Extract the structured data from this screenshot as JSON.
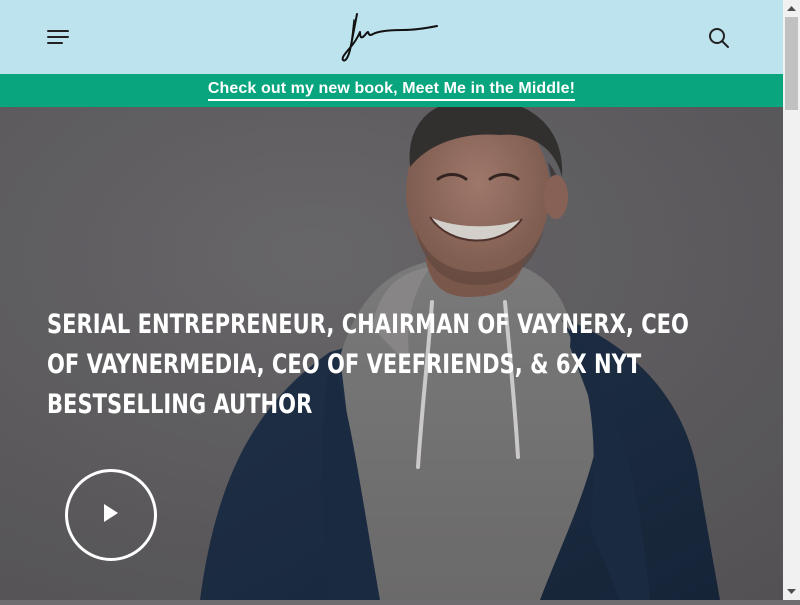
{
  "header": {
    "menu_icon": "hamburger-menu-icon",
    "logo": "signature-logo",
    "search_icon": "search-icon",
    "background_color": "#bde4ee"
  },
  "banner": {
    "link_text": "Check out my new book, Meet Me in the Middle!",
    "background_color": "#08a57e"
  },
  "hero": {
    "headline": "Serial Entrepreneur, Chairman of VaynerX, CEO of VaynerMedia, CEO of VeeFriends, & 6x NYT Bestselling Author",
    "play_icon": "play-icon"
  },
  "scrollbar": {
    "up_icon": "scroll-up-arrow-icon",
    "down_icon": "scroll-down-arrow-icon"
  }
}
